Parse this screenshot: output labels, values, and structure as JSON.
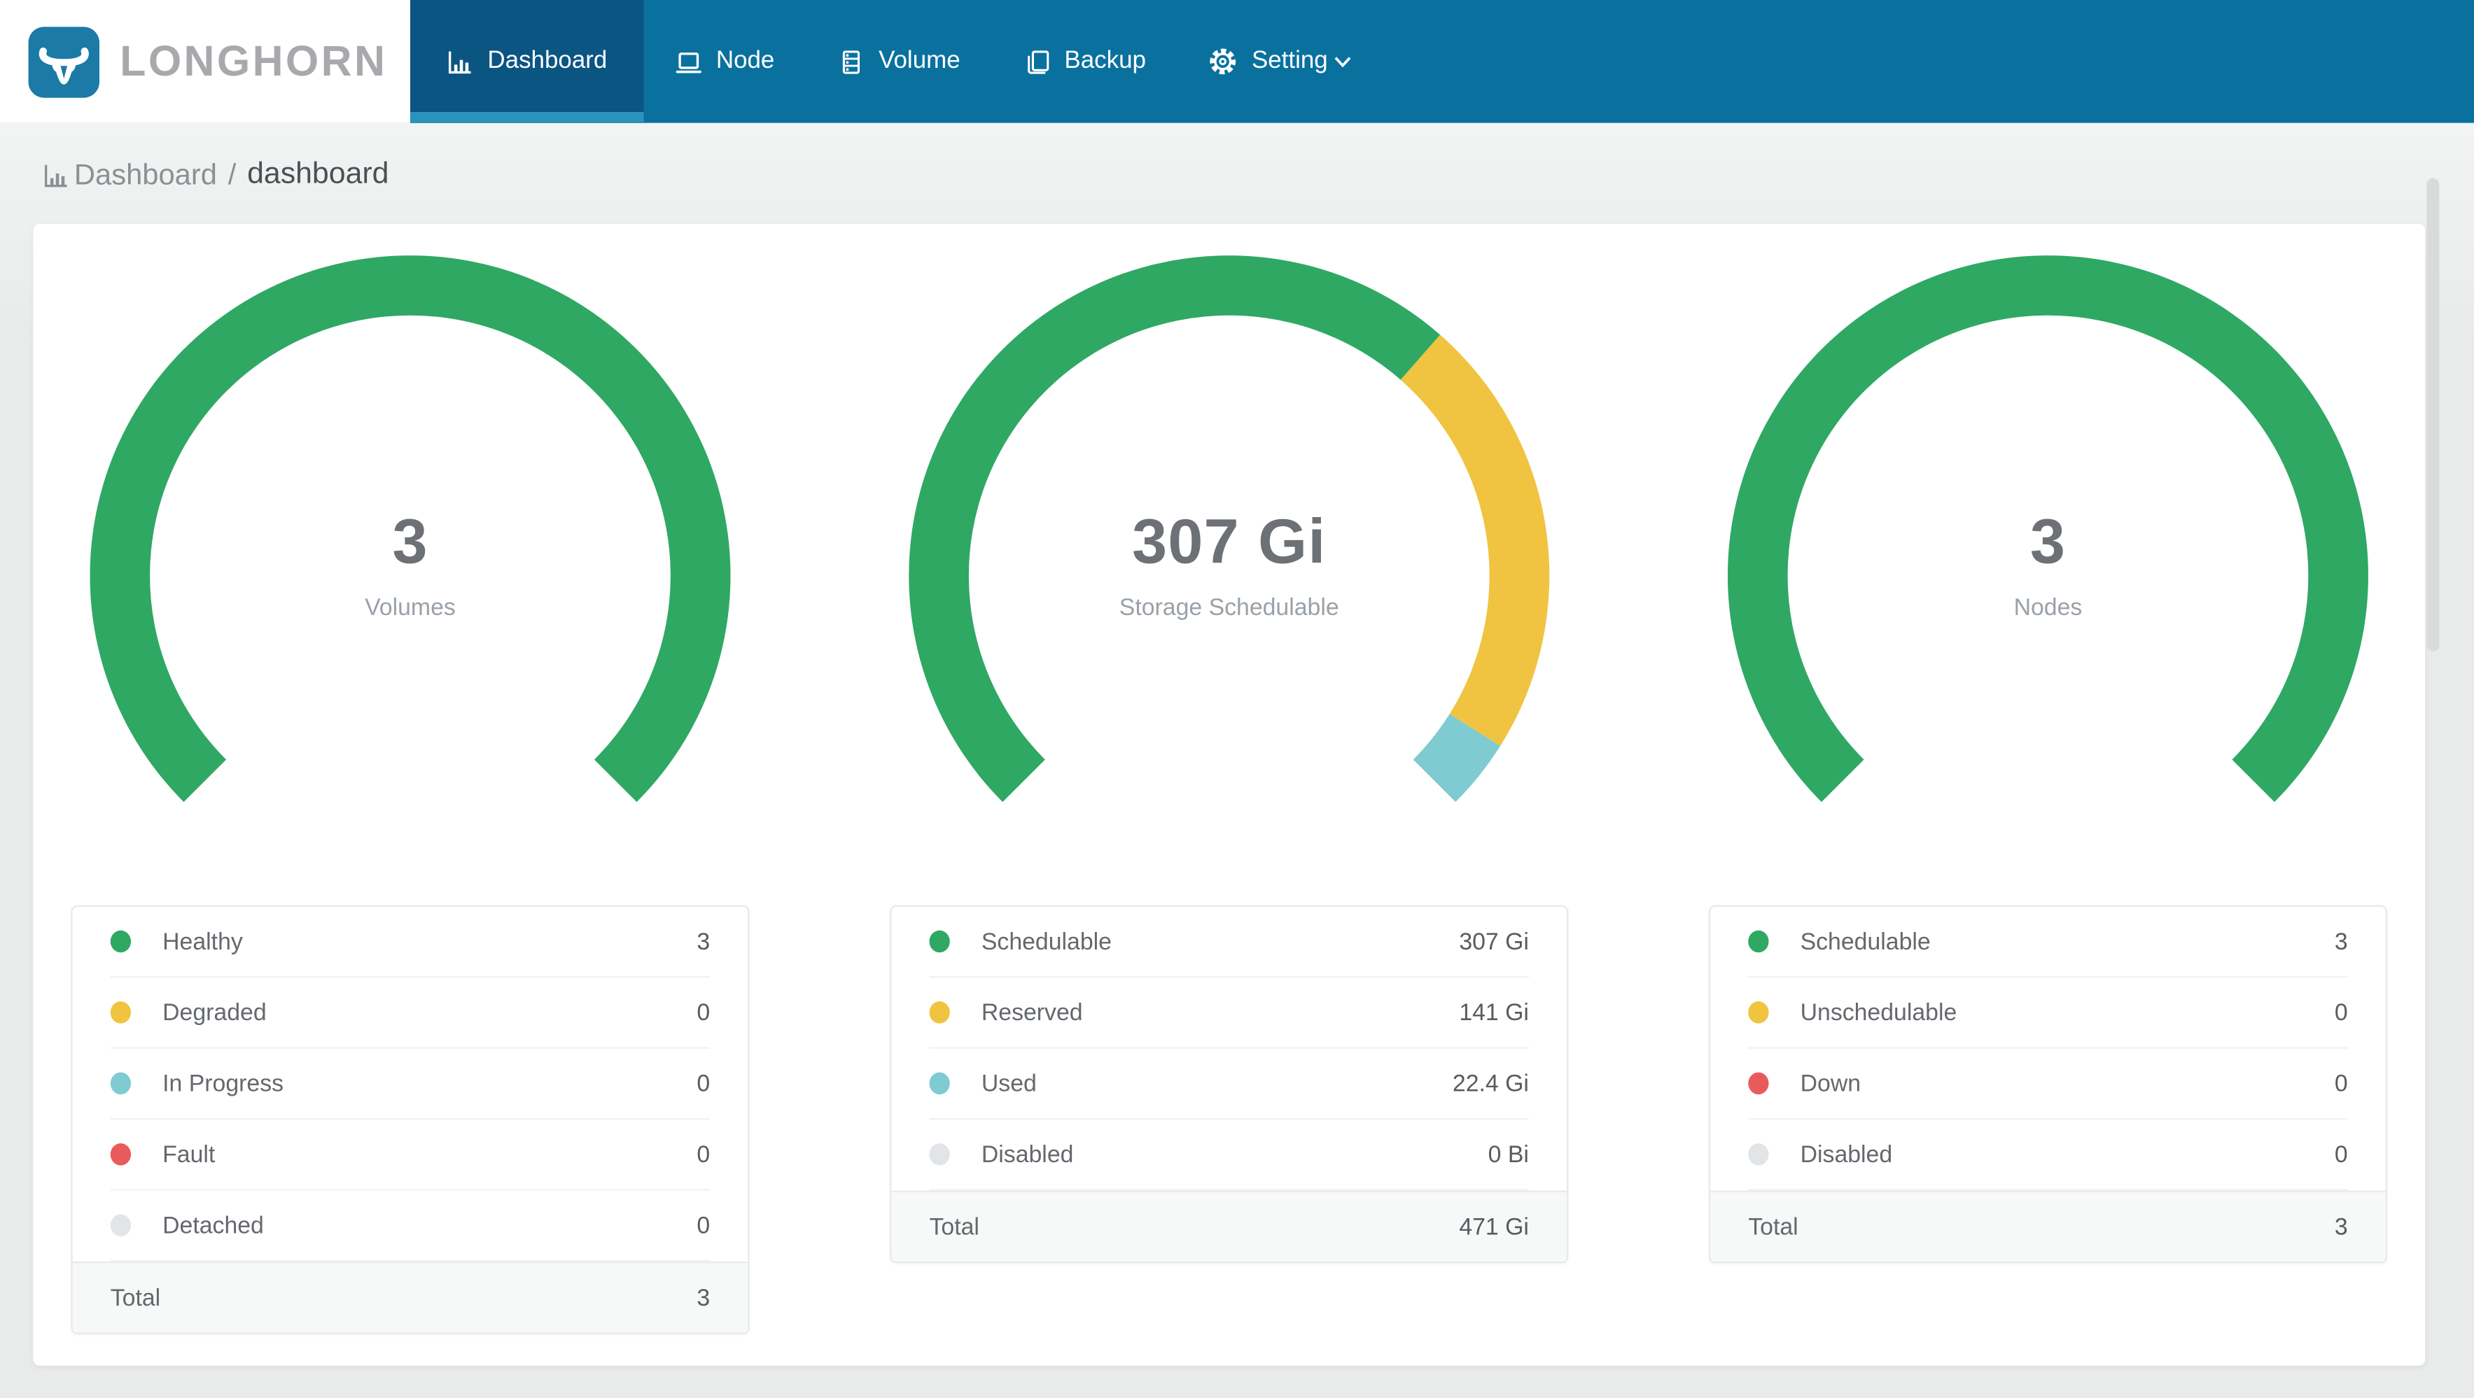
{
  "app": {
    "brand": "LONGHORN"
  },
  "nav": {
    "tabs": [
      {
        "label": "Dashboard",
        "icon": "bar-chart-icon",
        "active": true
      },
      {
        "label": "Node",
        "icon": "laptop-icon",
        "active": false
      },
      {
        "label": "Volume",
        "icon": "database-icon",
        "active": false
      },
      {
        "label": "Backup",
        "icon": "copy-icon",
        "active": false
      },
      {
        "label": "Setting",
        "icon": "gear-icon",
        "active": false,
        "has_chevron": true
      }
    ]
  },
  "breadcrumb": {
    "section": "Dashboard",
    "page": "dashboard"
  },
  "colors": {
    "nav_background": "#0A719F",
    "nav_active_background": "#0B5583",
    "nav_active_underline": "#2A93BC",
    "logo_blue": "#1B7AA6",
    "brand_text": "#A7A9AC",
    "page_background": "#E9EBEB",
    "healthy_green": "#2FA864",
    "warning_yellow": "#F0C440",
    "progress_teal": "#7FCBD2",
    "fault_red": "#E95A5C",
    "disabled_gray": "#E2E5E8"
  },
  "chart_data": [
    {
      "type": "pie",
      "variant": "gauge-donut",
      "title": "Volumes",
      "center_value": "3",
      "center_label": "Volumes",
      "gauge_span_degrees": 270,
      "segments": [
        {
          "label": "Healthy",
          "value": 3,
          "display": "3",
          "color": "#2FA864"
        },
        {
          "label": "Degraded",
          "value": 0,
          "display": "0",
          "color": "#F0C440"
        },
        {
          "label": "In Progress",
          "value": 0,
          "display": "0",
          "color": "#7FCBD2"
        },
        {
          "label": "Fault",
          "value": 0,
          "display": "0",
          "color": "#E95A5C"
        },
        {
          "label": "Detached",
          "value": 0,
          "display": "0",
          "color": "#E2E5E8"
        }
      ],
      "total_label": "Total",
      "total_display": "3"
    },
    {
      "type": "pie",
      "variant": "gauge-donut",
      "title": "Storage Schedulable",
      "center_value": "307 Gi",
      "center_label": "Storage Schedulable",
      "gauge_span_degrees": 270,
      "segments": [
        {
          "label": "Schedulable",
          "value": 307,
          "display": "307 Gi",
          "color": "#2FA864"
        },
        {
          "label": "Reserved",
          "value": 141,
          "display": "141 Gi",
          "color": "#F0C440"
        },
        {
          "label": "Used",
          "value": 22.4,
          "display": "22.4 Gi",
          "color": "#7FCBD2"
        },
        {
          "label": "Disabled",
          "value": 0,
          "display": "0 Bi",
          "color": "#E2E5E8"
        }
      ],
      "total_label": "Total",
      "total_display": "471 Gi"
    },
    {
      "type": "pie",
      "variant": "gauge-donut",
      "title": "Nodes",
      "center_value": "3",
      "center_label": "Nodes",
      "gauge_span_degrees": 270,
      "segments": [
        {
          "label": "Schedulable",
          "value": 3,
          "display": "3",
          "color": "#2FA864"
        },
        {
          "label": "Unschedulable",
          "value": 0,
          "display": "0",
          "color": "#F0C440"
        },
        {
          "label": "Down",
          "value": 0,
          "display": "0",
          "color": "#E95A5C"
        },
        {
          "label": "Disabled",
          "value": 0,
          "display": "0",
          "color": "#E2E5E8"
        }
      ],
      "total_label": "Total",
      "total_display": "3"
    }
  ]
}
